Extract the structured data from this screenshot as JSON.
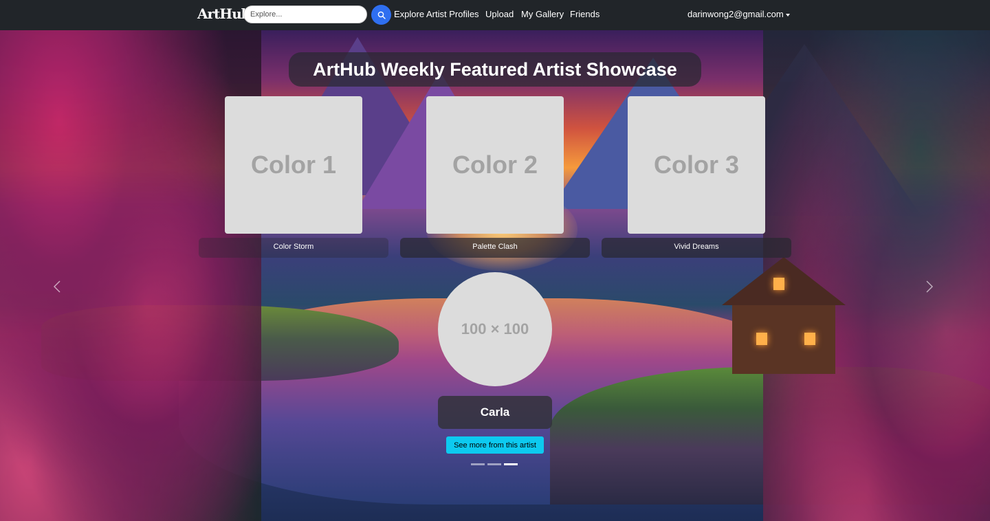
{
  "navbar": {
    "brand": "ArtHub",
    "search": {
      "placeholder": "Explore...",
      "value": ""
    },
    "search_icon": "search-icon",
    "links": [
      "Explore Artist Profiles",
      "Upload",
      "My Gallery",
      "Friends"
    ],
    "user_email": "darinwong2@gmail.com",
    "background_color": "#212529",
    "search_button_color": "#2f6ff0"
  },
  "showcase": {
    "title": "ArtHub Weekly Featured Artist Showcase",
    "artworks": [
      {
        "placeholder": "Color 1",
        "title": "Color Storm"
      },
      {
        "placeholder": "Color 2",
        "title": "Palette Clash"
      },
      {
        "placeholder": "Color 3",
        "title": "Vivid Dreams"
      }
    ],
    "avatar_placeholder": "100 × 100",
    "artist_name": "Carla",
    "see_more_label": "See more from this artist",
    "see_more_color": "#0dcaf0",
    "slide_count": 3,
    "active_slide": 3,
    "prev_icon": "chevron-left-icon",
    "next_icon": "chevron-right-icon"
  }
}
